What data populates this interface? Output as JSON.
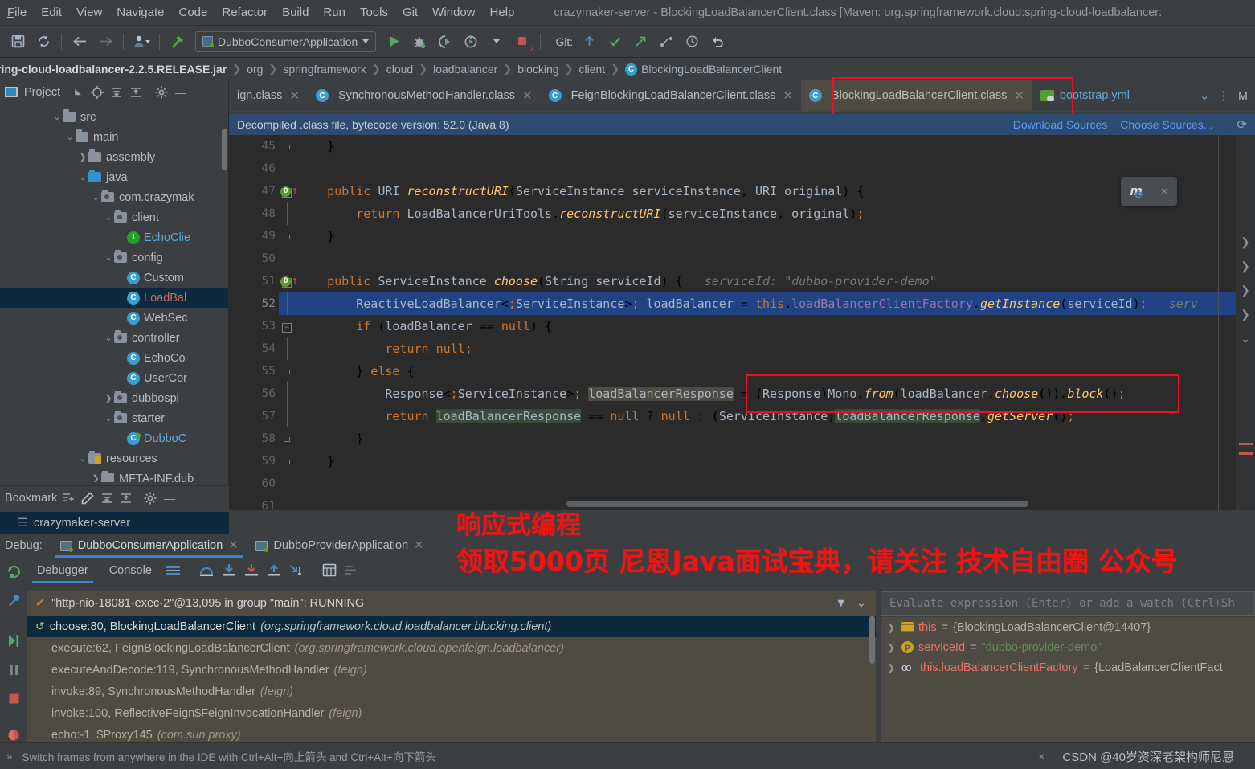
{
  "window": {
    "title": "crazymaker-server - BlockingLoadBalancerClient.class [Maven: org.springframework.cloud:spring-cloud-loadbalancer:"
  },
  "menubar": {
    "items": [
      "File",
      "Edit",
      "View",
      "Navigate",
      "Code",
      "Refactor",
      "Build",
      "Run",
      "Tools",
      "Git",
      "Window",
      "Help"
    ]
  },
  "toolbar": {
    "save_icon": "save-icon",
    "sync_icon": "sync-icon",
    "back_icon": "back-arrow-icon",
    "forward_icon": "forward-arrow-icon",
    "profile_icon": "user-icon",
    "build_icon": "hammer-icon",
    "run_config": "DubboConsumerApplication",
    "run_icon": "run-icon",
    "debug_icon": "debug-icon",
    "coverage_icon": "run-with-coverage-icon",
    "profiler_icon": "profiler-icon",
    "stop_icon": "stop-icon",
    "stop_badge": "2",
    "git_label": "Git:",
    "git_update_icon": "update-project-icon",
    "git_commit_icon": "commit-icon",
    "git_push_icon": "push-icon",
    "git_branch_icon": "branches-icon",
    "git_history_icon": "history-icon",
    "git_rollback_icon": "rollback-icon"
  },
  "breadcrumb": {
    "jar": "ring-cloud-loadbalancer-2.2.5.RELEASE.jar",
    "segments": [
      "org",
      "springframework",
      "cloud",
      "loadbalancer",
      "blocking",
      "client"
    ],
    "class": "BlockingLoadBalancerClient",
    "class_badge": "C"
  },
  "sidebar": {
    "title": "Project",
    "icons": [
      "project-view-icon",
      "collapse-chevron-icon",
      "locate-icon",
      "expand-all-icon",
      "collapse-all-icon",
      "gear-icon",
      "hide-icon"
    ],
    "tree": [
      {
        "label": "src",
        "indent": 4,
        "twisty": "v",
        "icon": "folder",
        "color": ""
      },
      {
        "label": "main",
        "indent": 5,
        "twisty": "v",
        "icon": "folder",
        "color": ""
      },
      {
        "label": "assembly",
        "indent": 6,
        "twisty": ">",
        "icon": "folder",
        "color": ""
      },
      {
        "label": "java",
        "indent": 6,
        "twisty": "v",
        "icon": "folder-blue",
        "color": ""
      },
      {
        "label": "com.crazymak",
        "indent": 7,
        "twisty": "v",
        "icon": "package",
        "color": ""
      },
      {
        "label": "client",
        "indent": 8,
        "twisty": "v",
        "icon": "package",
        "color": ""
      },
      {
        "label": "EchoClie",
        "indent": 9,
        "twisty": "",
        "icon": "interface",
        "color": "blue"
      },
      {
        "label": "config",
        "indent": 8,
        "twisty": "v",
        "icon": "package",
        "color": ""
      },
      {
        "label": "Custom",
        "indent": 9,
        "twisty": "",
        "icon": "class",
        "color": ""
      },
      {
        "label": "LoadBal",
        "indent": 9,
        "twisty": "",
        "icon": "class",
        "color": "red",
        "selected": true
      },
      {
        "label": "WebSec",
        "indent": 9,
        "twisty": "",
        "icon": "class",
        "color": ""
      },
      {
        "label": "controller",
        "indent": 8,
        "twisty": "v",
        "icon": "package",
        "color": ""
      },
      {
        "label": "EchoCo",
        "indent": 9,
        "twisty": "",
        "icon": "class",
        "color": ""
      },
      {
        "label": "UserCor",
        "indent": 9,
        "twisty": "",
        "icon": "class",
        "color": ""
      },
      {
        "label": "dubbospi",
        "indent": 8,
        "twisty": ">",
        "icon": "package",
        "color": ""
      },
      {
        "label": "starter",
        "indent": 8,
        "twisty": "v",
        "icon": "package",
        "color": ""
      },
      {
        "label": "DubboC",
        "indent": 9,
        "twisty": "",
        "icon": "class-run",
        "color": "blue"
      },
      {
        "label": "resources",
        "indent": 6,
        "twisty": "v",
        "icon": "folder-res",
        "color": ""
      },
      {
        "label": "MFTA-INF.dub",
        "indent": 7,
        "twisty": ">",
        "icon": "folder",
        "color": ""
      }
    ]
  },
  "bookmarks": {
    "title": "Bookmark",
    "icons": [
      "add-bookmark-icon",
      "edit-icon",
      "expand-all-icon",
      "collapse-all-icon",
      "gear-icon",
      "hide-icon"
    ],
    "row_label": "crazymaker-server",
    "row_icon": "list-icon"
  },
  "editor_tabs": {
    "tabs": [
      {
        "label": "ign.class",
        "icon": "",
        "active": false
      },
      {
        "label": "SynchronousMethodHandler.class",
        "icon": "class-badge",
        "active": false
      },
      {
        "label": "FeignBlockingLoadBalancerClient.class",
        "icon": "class-badge",
        "active": false
      },
      {
        "label": "BlockingLoadBalancerClient.class",
        "icon": "class-badge",
        "active": true
      },
      {
        "label": "bootstrap.yml",
        "icon": "yml-badge",
        "active": false
      }
    ],
    "right_icons": [
      "chevron-down-icon",
      "more-vertical-icon",
      "maven-label"
    ]
  },
  "notice": {
    "text": "Decompiled .class file, bytecode version: 52.0 (Java 8)",
    "download_sources": "Download Sources",
    "choose_sources": "Choose Sources...",
    "refresh_icon": "refresh-icon"
  },
  "code": {
    "lines": [
      {
        "n": "45",
        "fold": "end",
        "text": "    }"
      },
      {
        "n": "46",
        "fold": "",
        "text": ""
      },
      {
        "n": "47",
        "fold": "start",
        "marker": true,
        "text": "    public URI reconstructURI(ServiceInstance serviceInstance, URI original) {"
      },
      {
        "n": "48",
        "fold": "bar",
        "text": "        return LoadBalancerUriTools.reconstructURI(serviceInstance, original);"
      },
      {
        "n": "49",
        "fold": "end",
        "text": "    }"
      },
      {
        "n": "50",
        "fold": "",
        "text": ""
      },
      {
        "n": "51",
        "fold": "start",
        "marker": true,
        "text": "    public ServiceInstance choose(String serviceId) {",
        "hint": "serviceId: \"dubbo-provider-demo\""
      },
      {
        "n": "52",
        "fold": "bar",
        "highlight": true,
        "text": "        ReactiveLoadBalancer<ServiceInstance> loadBalancer = this.loadBalancerClientFactory.getInstance(serviceId);",
        "hint": "serv"
      },
      {
        "n": "53",
        "fold": "start",
        "text": "        if (loadBalancer == null) {"
      },
      {
        "n": "54",
        "fold": "bar",
        "text": "            return null;"
      },
      {
        "n": "55",
        "fold": "end",
        "text": "        } else {"
      },
      {
        "n": "56",
        "fold": "bar",
        "text": "            Response<ServiceInstance> loadBalancerResponse = (Response)Mono.from(loadBalancer.choose()).block();"
      },
      {
        "n": "57",
        "fold": "bar",
        "text": "            return loadBalancerResponse == null ? null : (ServiceInstance)loadBalancerResponse.getServer();"
      },
      {
        "n": "58",
        "fold": "end",
        "text": "        }"
      },
      {
        "n": "59",
        "fold": "end",
        "text": "    }"
      },
      {
        "n": "60",
        "fold": "",
        "text": ""
      },
      {
        "n": "61",
        "fold": "",
        "text": ""
      }
    ],
    "maven_widget": {
      "label": "m",
      "icon": "maven-reload-icon",
      "close": "×"
    }
  },
  "debug": {
    "label": "Debug:",
    "tabs": [
      {
        "label": "DubboConsumerApplication",
        "active": true
      },
      {
        "label": "DubboProviderApplication",
        "active": false
      }
    ],
    "subtabs": [
      {
        "label": "Debugger",
        "active": true
      },
      {
        "label": "Console",
        "active": false
      }
    ],
    "toolbar_icons": [
      "layout-icon",
      "step-over-icon",
      "step-into-icon",
      "force-step-into-icon",
      "step-out-icon",
      "run-to-cursor-icon",
      "evaluate-icon",
      "threads-icon"
    ],
    "rail_icons": [
      "rerun-icon",
      "settings-wrench-icon",
      "resume-icon",
      "pause-icon",
      "stop-icon",
      "mute-breakpoints-icon"
    ],
    "thread_status": "\"http-nio-18081-exec-2\"@13,095 in group \"main\": RUNNING",
    "thread_check_icon": "check-icon",
    "filter_icon": "filter-icon",
    "filter_chevron": "chevron-down-icon",
    "frames": [
      {
        "method": "choose:80, BlockingLoadBalancerClient",
        "pkg": "(org.springframework.cloud.loadbalancer.blocking.client)",
        "selected": true,
        "icon": "return-icon"
      },
      {
        "method": "execute:62, FeignBlockingLoadBalancerClient",
        "pkg": "(org.springframework.cloud.openfeign.loadbalancer)",
        "selected": false
      },
      {
        "method": "executeAndDecode:119, SynchronousMethodHandler",
        "pkg": "(feign)",
        "selected": false
      },
      {
        "method": "invoke:89, SynchronousMethodHandler",
        "pkg": "(feign)",
        "selected": false
      },
      {
        "method": "invoke:100, ReflectiveFeign$FeignInvocationHandler",
        "pkg": "(feign)",
        "selected": false
      },
      {
        "method": "echo:-1, $Proxy145",
        "pkg": "(com.sun.proxy)",
        "selected": false
      }
    ],
    "evaluate_placeholder": "Evaluate expression (Enter) or add a watch (Ctrl+Sh",
    "variables": [
      {
        "icon": "field-icon",
        "name": "this",
        "eq": "=",
        "value": "{BlockingLoadBalancerClient@14407}"
      },
      {
        "icon": "param-icon",
        "name": "serviceId",
        "eq": "=",
        "value": "\"dubbo-provider-demo\"",
        "is_string": true
      },
      {
        "icon": "ref-icon",
        "name": "this.loadBalancerClientFactory",
        "eq": "=",
        "value": "{LoadBalancerClientFact"
      }
    ]
  },
  "statusbar": {
    "expand_icon": "expand-icon",
    "tip": "Switch frames from anywhere in the IDE with Ctrl+Alt+向上箭头 and Ctrl+Alt+向下箭头",
    "close_icon": "×",
    "watermark": "CSDN @40岁资深老架构师尼恩"
  },
  "annotations": [
    {
      "id": "anno-1",
      "text": "响应式编程"
    },
    {
      "id": "anno-2",
      "text": "领取5000页 尼恩Java面试宝典，请关注 技术自由圈 公众号"
    }
  ],
  "colors": {
    "accent_blue": "#3d85d1",
    "red_highlight": "#e81123",
    "annotation_red": "#f01414",
    "editor_bg": "#2b2b2b",
    "panel_bg": "#3c3f41",
    "selection_blue": "#214283",
    "notice_bg": "#2d4b70"
  }
}
